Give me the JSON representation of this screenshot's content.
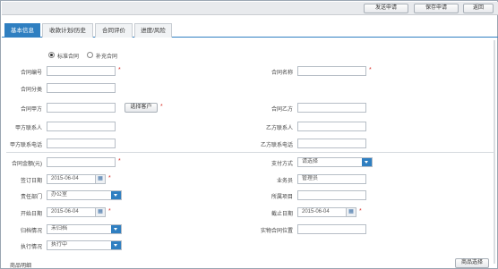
{
  "toolbar": {
    "send_label": "发送申请",
    "save_label": "保存申请",
    "back_label": "返回"
  },
  "tabs": [
    {
      "label": "基本信息",
      "active": true
    },
    {
      "label": "收款计划/历史",
      "active": false
    },
    {
      "label": "合同评价",
      "active": false
    },
    {
      "label": "进度/风险",
      "active": false
    }
  ],
  "contract_type": {
    "options": [
      "标准合同",
      "补充合同"
    ],
    "selected": "标准合同"
  },
  "form": {
    "contract_no_label": "合同编号",
    "contract_no_value": "",
    "contract_name_label": "合同名称",
    "contract_name_value": "",
    "category_label": "合同分类",
    "category_value": "",
    "party_a_label": "合同甲方",
    "party_a_value": "",
    "select_customer_label": "选择客户",
    "party_b_label": "合同乙方",
    "party_b_value": "",
    "a_contact_label": "甲方联系人",
    "a_contact_value": "",
    "b_contact_label": "乙方联系人",
    "b_contact_value": "",
    "a_phone_label": "甲方联系电话",
    "a_phone_value": "",
    "b_phone_label": "乙方联系电话",
    "b_phone_value": "",
    "amount_label": "合同金额(元)",
    "amount_value": "",
    "payment_label": "支付方式",
    "payment_value": "请选择",
    "sign_date_label": "签订日期",
    "sign_date_value": "2015-06-04",
    "salesman_label": "业务员",
    "salesman_value": "管理员",
    "dept_label": "责任部门",
    "dept_value": "办公室",
    "project_label": "所属项目",
    "project_value": "",
    "start_date_label": "开始日期",
    "start_date_value": "2015-06-04",
    "end_date_label": "截止日期",
    "end_date_value": "2015-06-04",
    "archive_label": "归档情况",
    "archive_value": "未归档",
    "location_label": "实物合同位置",
    "location_value": "",
    "exec_label": "执行情况",
    "exec_value": "执行中",
    "goods_label": "商品明细",
    "goods_button_label": "商品选择"
  },
  "colors": {
    "accent": "#2f7fc1",
    "required": "#d9322b"
  },
  "icons": {
    "calendar": "calendar-icon",
    "dropdown": "chevron-down-icon"
  }
}
